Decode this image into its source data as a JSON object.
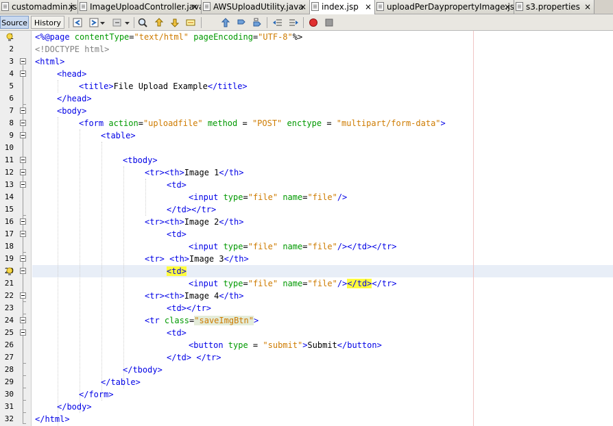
{
  "tabs": [
    {
      "label": "customadmin.js",
      "active": false
    },
    {
      "label": "ImageUploadController.java",
      "active": false
    },
    {
      "label": "AWSUploadUtility.java",
      "active": false
    },
    {
      "label": "index.jsp",
      "active": true
    },
    {
      "label": "uploadPerDaypropertyImage.jsp",
      "active": false
    },
    {
      "label": "s3.properties",
      "active": false
    }
  ],
  "tab_close_glyph": "×",
  "toolbar": {
    "source_label": "Source",
    "history_label": "History"
  },
  "line_numbers": [
    "1",
    "2",
    "3",
    "4",
    "5",
    "6",
    "7",
    "8",
    "9",
    "10",
    "11",
    "12",
    "13",
    "14",
    "15",
    "16",
    "17",
    "18",
    "19",
    "20",
    "21",
    "22",
    "23",
    "24",
    "25",
    "26",
    "27",
    "28",
    "29",
    "30",
    "31",
    "32"
  ],
  "code": {
    "l1": [
      "<%@page ",
      "contentType",
      "=",
      "\"text/html\"",
      " ",
      "pageEncoding",
      "=",
      "\"UTF-8\"",
      "%>"
    ],
    "l2": "<!DOCTYPE html>",
    "l3": "<html>",
    "l4": "<head>",
    "l5": [
      "<title>",
      "File Upload Example",
      "</title>"
    ],
    "l6": "</head>",
    "l7": "<body>",
    "l8": [
      "<form ",
      "action",
      "=",
      "\"uploadfile\"",
      " ",
      "method",
      " = ",
      "\"POST\"",
      " ",
      "enctype",
      " = ",
      "\"multipart/form-data\"",
      ">"
    ],
    "l9": "<table>",
    "l10": "",
    "l11": "<tbody>",
    "l12": [
      "<tr><th>",
      "Image 1",
      "</th>"
    ],
    "l13": "<td>",
    "l14": [
      "<input ",
      "type",
      "=",
      "\"file\"",
      " ",
      "name",
      "=",
      "\"file\"",
      "/>"
    ],
    "l15": "</td></tr>",
    "l16": [
      "<tr><th>",
      "Image 2",
      "</th>"
    ],
    "l17": "<td>",
    "l18": [
      "<input ",
      "type",
      "=",
      "\"file\"",
      " ",
      "name",
      "=",
      "\"file\"",
      "/></td></tr>"
    ],
    "l19": [
      "<tr> <th>",
      "Image 3",
      "</th>"
    ],
    "l20": "<td>",
    "l21": [
      "<input ",
      "type",
      "=",
      "\"file\"",
      " ",
      "name",
      "=",
      "\"file\"",
      "/>",
      "</td>",
      "</tr>"
    ],
    "l22": [
      "<tr><th>",
      "Image 4",
      "</th>"
    ],
    "l23": "<td></tr>",
    "l24": [
      "<tr ",
      "class",
      "=",
      "\"saveImgBtn\"",
      ">"
    ],
    "l25": "<td>",
    "l26": [
      "<button ",
      "type",
      " = ",
      "\"submit\"",
      ">",
      "Submit",
      "</button>"
    ],
    "l27": "</td> </tr>",
    "l28": "</tbody>",
    "l29": "</table>",
    "l30": "</form>",
    "l31": "</body>",
    "l32": "</html>"
  },
  "colors": {
    "tag": "#0000e6",
    "attr": "#009900",
    "value": "#ce7b00",
    "doctype": "#808080",
    "highlight": "#fffc3c",
    "current_line": "#e8eef7"
  },
  "icons": [
    "back-icon",
    "forward-icon",
    "find-icon",
    "prev-occurrence-icon",
    "next-occurrence-icon",
    "toggle-highlight-icon",
    "toggle-bookmark-icon",
    "prev-bookmark-icon",
    "next-bookmark-icon",
    "shift-left-icon",
    "shift-right-icon",
    "record-macro-icon",
    "stop-macro-icon",
    "hint-bulb-icon",
    "fold-icon"
  ]
}
